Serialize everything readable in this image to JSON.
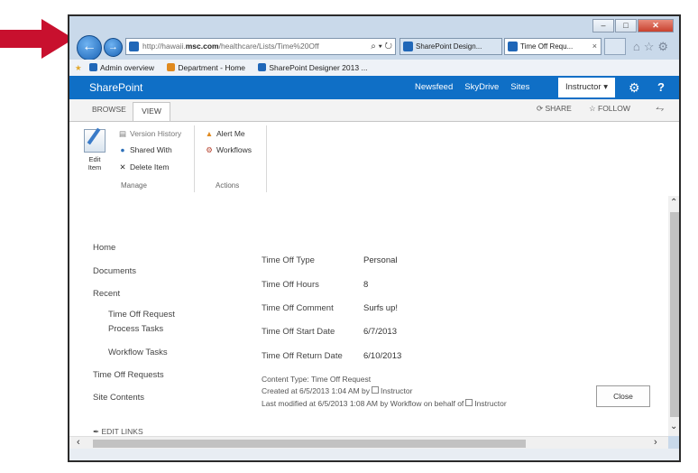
{
  "annotation": {
    "arrow_color": "#c8102e"
  },
  "browser": {
    "address": {
      "url_prefix": "http://hawaii.",
      "url_domain": "msc.com",
      "url_rest": "/healthcare/Lists/Time%20Off",
      "tools": "⌕ ▾ ↻"
    },
    "tabs": [
      {
        "label": "SharePoint Design..."
      },
      {
        "label": "Time Off Requ...",
        "close": "×"
      }
    ],
    "favorites": [
      {
        "label": "Admin overview"
      },
      {
        "label": "Department - Home"
      },
      {
        "label": "SharePoint Designer 2013 ..."
      }
    ]
  },
  "suite": {
    "brand": "SharePoint",
    "links": [
      "Newsfeed",
      "SkyDrive",
      "Sites"
    ],
    "user": "Instructor ▾",
    "help": "?",
    "accent": "#0f6fc6"
  },
  "ribbon": {
    "tabs": [
      "BROWSE",
      "VIEW"
    ],
    "share": "SHARE",
    "follow": "FOLLOW",
    "edit_item": "Edit Item",
    "version_history": "Version History",
    "shared_with": "Shared With",
    "delete_item": "Delete Item",
    "alert_me": "Alert Me",
    "workflows": "Workflows",
    "group_manage": "Manage",
    "group_actions": "Actions"
  },
  "leftnav": {
    "home": "Home",
    "documents": "Documents",
    "recent": "Recent",
    "sub1a": "Time Off Request",
    "sub1b": "Process Tasks",
    "sub2": "Workflow Tasks",
    "requests": "Time Off Requests",
    "contents": "Site Contents",
    "edit_links": "EDIT LINKS"
  },
  "fields": [
    {
      "label": "Time Off Type",
      "value": "Personal"
    },
    {
      "label": "Time Off Hours",
      "value": "8"
    },
    {
      "label": "Time Off Comment",
      "value": "Surfs up!"
    },
    {
      "label": "Time Off Start Date",
      "value": "6/7/2013"
    },
    {
      "label": "Time Off Return Date",
      "value": "6/10/2013"
    }
  ],
  "meta": {
    "content_type": "Content Type: Time Off Request",
    "created_prefix": "Created at 6/5/2013 1:04 AM  by",
    "created_user": "Instructor",
    "modified_prefix": "Last modified at 6/5/2013 1:08 AM  by Workflow on behalf of",
    "modified_user": "Instructor"
  },
  "close_label": "Close"
}
